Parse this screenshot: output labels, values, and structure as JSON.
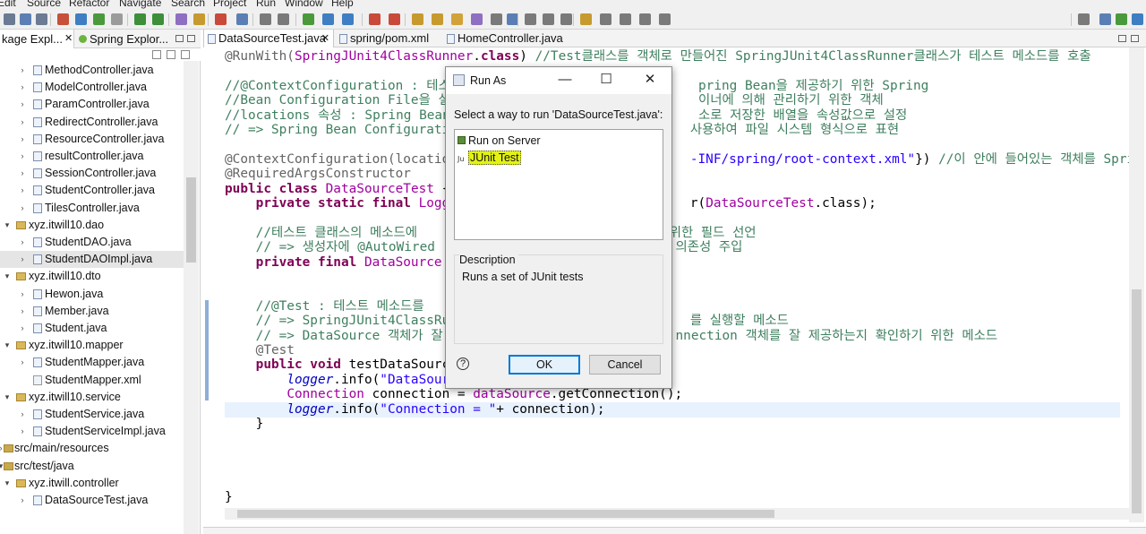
{
  "menu": [
    "Edit",
    "Source",
    "Refactor",
    "Navigate",
    "Search",
    "Project",
    "Run",
    "Window",
    "Help"
  ],
  "left_panel": {
    "tabs": [
      {
        "label": "kage Expl..."
      },
      {
        "label": "Spring Explor..."
      }
    ],
    "tree": [
      {
        "label": "MethodController.java",
        "kind": "file",
        "depth": 2,
        "expandable": true
      },
      {
        "label": "ModelController.java",
        "kind": "file",
        "depth": 2,
        "expandable": true
      },
      {
        "label": "ParamController.java",
        "kind": "file",
        "depth": 2,
        "expandable": true
      },
      {
        "label": "RedirectController.java",
        "kind": "file",
        "depth": 2,
        "expandable": true
      },
      {
        "label": "ResourceController.java",
        "kind": "file",
        "depth": 2,
        "expandable": true
      },
      {
        "label": "resultController.java",
        "kind": "file",
        "depth": 2,
        "expandable": true
      },
      {
        "label": "SessionController.java",
        "kind": "file",
        "depth": 2,
        "expandable": true
      },
      {
        "label": "StudentController.java",
        "kind": "file",
        "depth": 2,
        "expandable": true
      },
      {
        "label": "TilesController.java",
        "kind": "file",
        "depth": 2,
        "expandable": true
      },
      {
        "label": "xyz.itwill10.dao",
        "kind": "package",
        "depth": 1,
        "expanded": true
      },
      {
        "label": "StudentDAO.java",
        "kind": "file",
        "depth": 2,
        "expandable": true
      },
      {
        "label": "StudentDAOImpl.java",
        "kind": "file",
        "depth": 2,
        "expandable": true,
        "selected": true
      },
      {
        "label": "xyz.itwill10.dto",
        "kind": "package",
        "depth": 1,
        "expanded": true
      },
      {
        "label": "Hewon.java",
        "kind": "file",
        "depth": 2,
        "expandable": true
      },
      {
        "label": "Member.java",
        "kind": "file",
        "depth": 2,
        "expandable": true
      },
      {
        "label": "Student.java",
        "kind": "file",
        "depth": 2,
        "expandable": true
      },
      {
        "label": "xyz.itwill10.mapper",
        "kind": "package",
        "depth": 1,
        "expanded": true
      },
      {
        "label": "StudentMapper.java",
        "kind": "file",
        "depth": 2,
        "expandable": true
      },
      {
        "label": "StudentMapper.xml",
        "kind": "xml",
        "depth": 2,
        "expandable": false
      },
      {
        "label": "xyz.itwill10.service",
        "kind": "package",
        "depth": 1,
        "expanded": true
      },
      {
        "label": "StudentService.java",
        "kind": "file",
        "depth": 2,
        "expandable": true
      },
      {
        "label": "StudentServiceImpl.java",
        "kind": "file",
        "depth": 2,
        "expandable": true
      },
      {
        "label": "src/main/resources",
        "kind": "folder",
        "depth": 0,
        "expandable": true
      },
      {
        "label": "src/test/java",
        "kind": "folder",
        "depth": 0,
        "expanded": true
      },
      {
        "label": "xyz.itwill.controller",
        "kind": "package",
        "depth": 1,
        "expanded": true
      },
      {
        "label": "DataSourceTest.java",
        "kind": "file",
        "depth": 2,
        "expandable": true
      }
    ]
  },
  "editor": {
    "tabs": [
      {
        "label": "DataSourceTest.java",
        "active": true,
        "closable": true
      },
      {
        "label": "spring/pom.xml",
        "active": false,
        "closable": false
      },
      {
        "label": "HomeController.java",
        "active": false,
        "closable": false
      }
    ],
    "lines": [
      [
        {
          "t": "@RunWith(",
          "c": "an"
        },
        {
          "t": "SpringJUnit4ClassRunner",
          "c": "ty"
        },
        {
          "t": ".",
          "c": ""
        },
        {
          "t": "class",
          "c": "kw"
        },
        {
          "t": ") ",
          "c": ""
        },
        {
          "t": "//Test클래스를 객체로 만들어진 SpringJUnit4ClassRunner클래스가 테스트 메소드를 호출",
          "c": "cm"
        }
      ],
      [],
      [
        {
          "t": "//@ContextConfiguration : 테스",
          "c": "cm"
        },
        {
          "t": "                                ",
          "c": ""
        },
        {
          "t": "pring Bean을 제공하기 위한 Spring",
          "c": "cm"
        }
      ],
      [
        {
          "t": "//Bean Configuration File을 설",
          "c": "cm"
        },
        {
          "t": "                                ",
          "c": ""
        },
        {
          "t": "이너에 의해 관리하기 위한 객체",
          "c": "cm"
        }
      ],
      [
        {
          "t": "//locations 속성 : Spring Bean",
          "c": "cm"
        },
        {
          "t": "                                ",
          "c": ""
        },
        {
          "t": "소로 저장한 배열을 속성값으로 설정",
          "c": "cm"
        }
      ],
      [
        {
          "t": "// => Spring Bean Configuratio",
          "c": "cm"
        },
        {
          "t": "                              ",
          "c": ""
        },
        {
          "t": "사용하여 파일 시스템 형식으로 표현",
          "c": "cm"
        }
      ],
      [],
      [
        {
          "t": "@ContextConfiguration(location",
          "c": "an"
        },
        {
          "t": "                              ",
          "c": ""
        },
        {
          "t": "-INF/spring/root-context.xml\"",
          "c": "st"
        },
        {
          "t": "}) ",
          "c": ""
        },
        {
          "t": "//이 안에 들어있는 객체를 Spri",
          "c": "cm"
        }
      ],
      [
        {
          "t": "@RequiredArgsConstructor",
          "c": "an"
        }
      ],
      [
        {
          "t": "public class ",
          "c": "kw"
        },
        {
          "t": "DataSourceTest",
          "c": "ty"
        },
        {
          "t": " {",
          "c": ""
        }
      ],
      [
        {
          "t": "    private static final ",
          "c": "kw"
        },
        {
          "t": "Logge",
          "c": "ty"
        },
        {
          "t": "                              ",
          "c": ""
        },
        {
          "t": "r(",
          "c": ""
        },
        {
          "t": "DataSourceTest",
          "c": "ty"
        },
        {
          "t": ".class);",
          "c": ""
        }
      ],
      [],
      [
        {
          "t": "    //테스트 클래스의 메소드에",
          "c": "cm"
        },
        {
          "t": "                              ",
          "c": ""
        },
        {
          "t": "기 위한 필드 선언",
          "c": "cm"
        }
      ],
      [
        {
          "t": "    // => 생성자에 @AutoWired ",
          "c": "cm"
        },
        {
          "t": "                              ",
          "c": ""
        },
        {
          "t": "의존성 주입",
          "c": "cm"
        }
      ],
      [
        {
          "t": "    private final ",
          "c": "kw"
        },
        {
          "t": "DataSource",
          "c": "ty"
        },
        {
          "t": " d",
          "c": ""
        }
      ],
      [],
      [],
      [
        {
          "t": "    //@Test : 테스트 메소드를",
          "c": "cm"
        }
      ],
      [
        {
          "t": "    // => SpringJUnit4ClassRun",
          "c": "cm"
        },
        {
          "t": "                              ",
          "c": ""
        },
        {
          "t": "를 실행할 메소드",
          "c": "cm"
        }
      ],
      [
        {
          "t": "    // => DataSource 객체가 잘",
          "c": "cm"
        },
        {
          "t": "                              ",
          "c": ""
        },
        {
          "t": "nnection 객체를 잘 제공하는지 확인하기 위한 메소드",
          "c": "cm"
        }
      ],
      [
        {
          "t": "    @Test",
          "c": "an"
        }
      ],
      [
        {
          "t": "    public void ",
          "c": "kw"
        },
        {
          "t": "testDataSource",
          "c": ""
        }
      ],
      [
        {
          "t": "        ",
          "c": ""
        },
        {
          "t": "logger",
          "c": "fd"
        },
        {
          "t": ".info(",
          "c": ""
        },
        {
          "t": "\"DataSourc",
          "c": "st"
        }
      ],
      [
        {
          "t": "        ",
          "c": ""
        },
        {
          "t": "Connection",
          "c": "ty"
        },
        {
          "t": " connection = ",
          "c": ""
        },
        {
          "t": "dataSource",
          "c": "ty"
        },
        {
          "t": ".getConnection();",
          "c": ""
        }
      ],
      [
        {
          "t": "        ",
          "c": ""
        },
        {
          "t": "logger",
          "c": "fd"
        },
        {
          "t": ".info(",
          "c": ""
        },
        {
          "t": "\"Connection = \"",
          "c": "st"
        },
        {
          "t": "+ connection);",
          "c": ""
        }
      ],
      [
        {
          "t": "    }",
          "c": ""
        }
      ],
      [],
      [],
      [],
      [],
      [
        {
          "t": "}",
          "c": ""
        }
      ]
    ],
    "highlighted_line": 24
  },
  "dialog": {
    "title": "Run As",
    "minimize_glyph": "—",
    "maximize_glyph": "☐",
    "close_glyph": "✕",
    "prompt": "Select a way to run 'DataSourceTest.java':",
    "options": [
      {
        "label": "Run on Server",
        "icon": "server-icon",
        "selected": false
      },
      {
        "label": "JUnit Test",
        "icon": "junit-icon",
        "selected": true
      }
    ],
    "description_label": "Description",
    "description_text": "Runs a set of JUnit tests",
    "help_glyph": "?",
    "ok_label": "OK",
    "cancel_label": "Cancel",
    "selection_color": "#e3f215"
  },
  "colors": {
    "comment": "#3f7f5f",
    "keyword": "#7f0055",
    "string": "#2a00ff",
    "field": "#0000c0",
    "accent": "#0078d7"
  }
}
